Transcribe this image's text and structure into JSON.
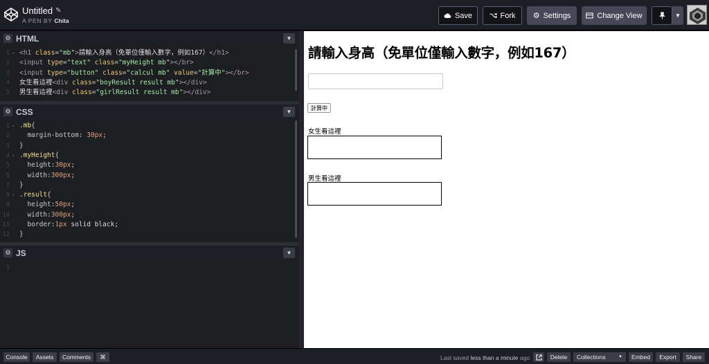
{
  "header": {
    "pen_title": "Untitled",
    "pen_by_prefix": "A PEN BY",
    "author": "Chita",
    "buttons": {
      "save": "Save",
      "fork": "Fork",
      "settings": "Settings",
      "change_view": "Change View"
    }
  },
  "panes": {
    "html": {
      "title": "HTML"
    },
    "css": {
      "title": "CSS"
    },
    "js": {
      "title": "JS"
    }
  },
  "code": {
    "html_lines": [
      [
        [
          "t-tag",
          "<h1 "
        ],
        [
          "t-attr",
          "class"
        ],
        [
          "t-pun",
          "="
        ],
        [
          "t-str",
          "\"mb\""
        ],
        [
          "t-tag",
          ">"
        ],
        [
          "t-val2",
          "請輸入身高（免單位僅輸入數字，例如167）"
        ],
        [
          "t-tag",
          "</h1>"
        ]
      ],
      [
        [
          "t-tag",
          "<input "
        ],
        [
          "t-attr",
          "type"
        ],
        [
          "t-pun",
          "="
        ],
        [
          "t-str",
          "\"text\" "
        ],
        [
          "t-attr",
          "class"
        ],
        [
          "t-pun",
          "="
        ],
        [
          "t-str",
          "\"myHeight mb\""
        ],
        [
          "t-tag",
          "></br>"
        ]
      ],
      [
        [
          "t-tag",
          "<input "
        ],
        [
          "t-attr",
          "type"
        ],
        [
          "t-pun",
          "="
        ],
        [
          "t-str",
          "\"button\" "
        ],
        [
          "t-attr",
          "class"
        ],
        [
          "t-pun",
          "="
        ],
        [
          "t-str",
          "\"calcul mb\" "
        ],
        [
          "t-attr",
          "value"
        ],
        [
          "t-pun",
          "="
        ],
        [
          "t-str",
          "\"計算中\""
        ],
        [
          "t-tag",
          "></br>"
        ]
      ],
      [
        [
          "t-val2",
          "女生看這裡"
        ],
        [
          "t-tag",
          "<div "
        ],
        [
          "t-attr",
          "class"
        ],
        [
          "t-pun",
          "="
        ],
        [
          "t-str",
          "\"boyResult result mb\""
        ],
        [
          "t-tag",
          "></div>"
        ]
      ],
      [
        [
          "t-val2",
          "男生看這裡"
        ],
        [
          "t-tag",
          "<div "
        ],
        [
          "t-attr",
          "class"
        ],
        [
          "t-pun",
          "="
        ],
        [
          "t-str",
          "\"girlResult result mb\""
        ],
        [
          "t-tag",
          "></div>"
        ]
      ]
    ],
    "css_lines": [
      [
        [
          "t-sel",
          ".mb"
        ],
        [
          "t-pun",
          "{"
        ]
      ],
      [
        [
          "t-prop",
          "  margin-bottom"
        ],
        [
          "t-pun",
          ": "
        ],
        [
          "t-val",
          "30px"
        ],
        [
          "t-pun",
          ";"
        ]
      ],
      [
        [
          "t-pun",
          "}"
        ]
      ],
      [
        [
          "t-sel",
          ".myHeight"
        ],
        [
          "t-pun",
          "{"
        ]
      ],
      [
        [
          "t-prop",
          "  height"
        ],
        [
          "t-pun",
          ":"
        ],
        [
          "t-val",
          "30px"
        ],
        [
          "t-pun",
          ";"
        ]
      ],
      [
        [
          "t-prop",
          "  width"
        ],
        [
          "t-pun",
          ":"
        ],
        [
          "t-val",
          "300px"
        ],
        [
          "t-pun",
          ";"
        ]
      ],
      [
        [
          "t-pun",
          "}"
        ]
      ],
      [
        [
          "t-sel",
          ".result"
        ],
        [
          "t-pun",
          "{"
        ]
      ],
      [
        [
          "t-prop",
          "  height"
        ],
        [
          "t-pun",
          ":"
        ],
        [
          "t-val",
          "50px"
        ],
        [
          "t-pun",
          ";"
        ]
      ],
      [
        [
          "t-prop",
          "  width"
        ],
        [
          "t-pun",
          ":"
        ],
        [
          "t-val",
          "300px"
        ],
        [
          "t-pun",
          ";"
        ]
      ],
      [
        [
          "t-prop",
          "  border"
        ],
        [
          "t-pun",
          ":"
        ],
        [
          "t-val",
          "1px "
        ],
        [
          "t-val2",
          "solid black"
        ],
        [
          "t-pun",
          ";"
        ]
      ],
      [
        [
          "t-pun",
          "}"
        ]
      ]
    ],
    "js_line_numbers": [
      "1"
    ]
  },
  "preview": {
    "heading": "請輸入身高（免單位僅輸入數字，例如167）",
    "input_value": "",
    "button_value": "計算中",
    "girl_label": "女生看這裡",
    "boy_label": "男生看這裡"
  },
  "footer": {
    "console": "Console",
    "assets": "Assets",
    "comments": "Comments",
    "shortcut": "⌘",
    "saved_prefix": "Last saved",
    "saved_time": "less than a minute",
    "saved_suffix": "ago",
    "delete": "Delete",
    "collections": "Collections",
    "embed": "Embed",
    "export": "Export",
    "share": "Share"
  }
}
